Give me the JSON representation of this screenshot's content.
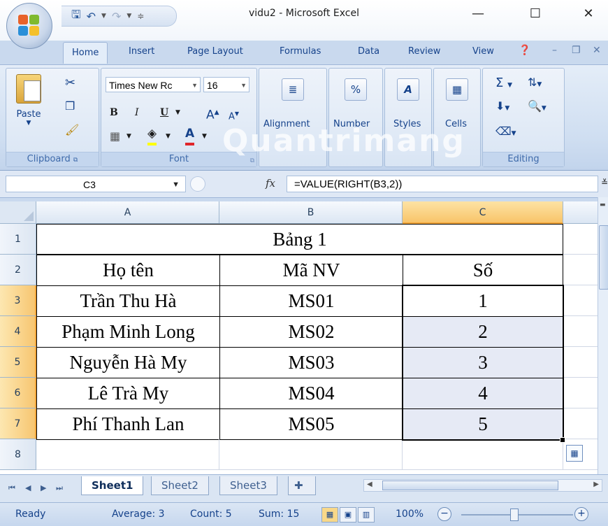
{
  "window": {
    "title": "vidu2 - Microsoft Excel",
    "minimize": "—",
    "maximize": "☐",
    "close": "✕"
  },
  "ribbon_tabs": [
    "Home",
    "Insert",
    "Page Layout",
    "Formulas",
    "Data",
    "Review",
    "View"
  ],
  "ribbon": {
    "clipboard": {
      "label": "Clipboard",
      "paste": "Paste"
    },
    "font": {
      "label": "Font",
      "family": "Times New Rc",
      "size": "16",
      "bold": "B",
      "italic": "I",
      "underline": "U"
    },
    "alignment": {
      "label": "Alignment"
    },
    "number": {
      "label": "Number"
    },
    "styles": {
      "label": "Styles"
    },
    "cells": {
      "label": "Cells"
    },
    "editing": {
      "label": "Editing"
    }
  },
  "watermark": "Quantrimang",
  "formula_bar": {
    "name_box": "C3",
    "fx": "fx",
    "formula": "=VALUE(RIGHT(B3,2))"
  },
  "columns": [
    "A",
    "B",
    "C"
  ],
  "rows": [
    "1",
    "2",
    "3",
    "4",
    "5",
    "6",
    "7",
    "8"
  ],
  "table": {
    "title": "Bảng 1",
    "headers": [
      "Họ tên",
      "Mã NV",
      "Số"
    ],
    "data": [
      [
        "Trần Thu Hà",
        "MS01",
        "1"
      ],
      [
        "Phạm Minh Long",
        "MS02",
        "2"
      ],
      [
        "Nguyễn Hà My",
        "MS03",
        "3"
      ],
      [
        "Lê Trà My",
        "MS04",
        "4"
      ],
      [
        "Phí Thanh Lan",
        "MS05",
        "5"
      ]
    ]
  },
  "sheet_tabs": [
    "Sheet1",
    "Sheet2",
    "Sheet3"
  ],
  "status": {
    "ready": "Ready",
    "average": "Average: 3",
    "count": "Count: 5",
    "sum": "Sum: 15",
    "zoom": "100%"
  },
  "colors": {
    "accent": "#15428b",
    "selected_header": "#f8c46a",
    "selection_fill": "#e6eaf5"
  }
}
